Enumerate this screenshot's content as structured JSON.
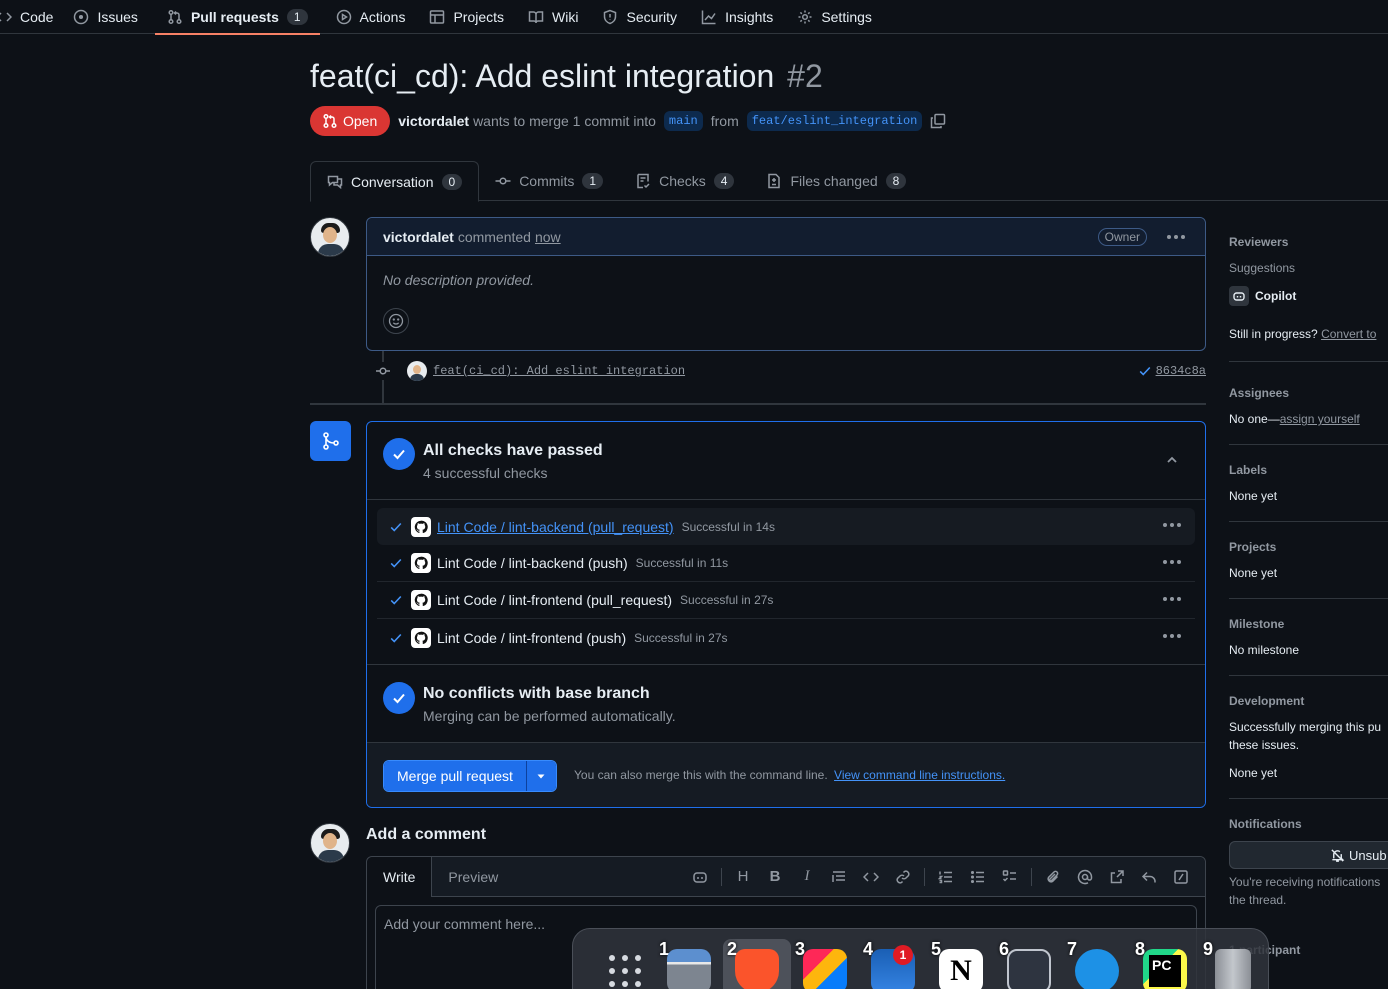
{
  "topnav": {
    "tabs": [
      {
        "label": "Code",
        "icon": "code-icon"
      },
      {
        "label": "Issues",
        "icon": "issue-icon"
      },
      {
        "label": "Pull requests",
        "icon": "pull-request-icon",
        "count": "1",
        "active": true
      },
      {
        "label": "Actions",
        "icon": "play-icon"
      },
      {
        "label": "Projects",
        "icon": "table-icon"
      },
      {
        "label": "Wiki",
        "icon": "book-icon"
      },
      {
        "label": "Security",
        "icon": "shield-icon"
      },
      {
        "label": "Insights",
        "icon": "graph-icon"
      },
      {
        "label": "Settings",
        "icon": "gear-icon"
      }
    ]
  },
  "pr": {
    "title": "feat(ci_cd): Add eslint integration",
    "number": "#2",
    "state": "Open",
    "author": "victordalet",
    "merge_text": "wants to merge 1 commit into",
    "base_branch": "main",
    "from_text": "from",
    "head_branch": "feat/eslint_integration"
  },
  "prtabs": [
    {
      "label": "Conversation",
      "count": "0",
      "icon": "comment-discussion-icon"
    },
    {
      "label": "Commits",
      "count": "1",
      "icon": "commit-icon"
    },
    {
      "label": "Checks",
      "count": "4",
      "icon": "checklist-icon"
    },
    {
      "label": "Files changed",
      "count": "8",
      "icon": "file-diff-icon"
    }
  ],
  "comment": {
    "author": "victordalet",
    "action": "commented",
    "when": "now",
    "badge": "Owner",
    "body": "No description provided."
  },
  "commit": {
    "message": "feat(ci_cd): Add eslint integration",
    "sha": "8634c8a"
  },
  "checks": {
    "title": "All checks have passed",
    "subtitle": "4 successful checks",
    "items": [
      {
        "name": "Lint Code / lint-backend (pull_request)",
        "status": "Successful in 14s"
      },
      {
        "name": "Lint Code / lint-backend (push)",
        "status": "Successful in 11s"
      },
      {
        "name": "Lint Code / lint-frontend (pull_request)",
        "status": "Successful in 27s"
      },
      {
        "name": "Lint Code / lint-frontend (push)",
        "status": "Successful in 27s"
      }
    ]
  },
  "conflicts": {
    "title": "No conflicts with base branch",
    "subtitle": "Merging can be performed automatically."
  },
  "merge": {
    "button": "Merge pull request",
    "hint": "You can also merge this with the command line.",
    "link": "View command line instructions."
  },
  "add_comment": {
    "title": "Add a comment",
    "write_tab": "Write",
    "preview_tab": "Preview",
    "placeholder": "Add your comment here...",
    "heading_glyph": "H",
    "bold_glyph": "B",
    "italic_glyph": "I"
  },
  "sidebar": {
    "reviewers": {
      "title": "Reviewers",
      "suggestions": "Suggestions",
      "copilot": "Copilot",
      "progress": "Still in progress?",
      "convert": "Convert to"
    },
    "assignees": {
      "title": "Assignees",
      "value": "No one—",
      "link": "assign yourself"
    },
    "labels": {
      "title": "Labels",
      "value": "None yet"
    },
    "projects": {
      "title": "Projects",
      "value": "None yet"
    },
    "milestone": {
      "title": "Milestone",
      "value": "No milestone"
    },
    "development": {
      "title": "Development",
      "line1": "Successfully merging this pu",
      "line2": "these issues.",
      "value": "None yet"
    },
    "notifications": {
      "title": "Notifications",
      "button": "Unsub",
      "line1": "You're receiving notifications",
      "line2": "the thread."
    },
    "participants": {
      "title": "1 participant"
    }
  },
  "dock": {
    "items": [
      {
        "num": "1",
        "icon": "file-manager-icon"
      },
      {
        "num": "2",
        "icon": "brave-browser-icon"
      },
      {
        "num": "3",
        "icon": "jetbrains-toolbox-icon"
      },
      {
        "num": "4",
        "icon": "email-client-icon",
        "badge": "1"
      },
      {
        "num": "5",
        "icon": "notion-icon"
      },
      {
        "num": "6",
        "icon": "system-monitor-icon"
      },
      {
        "num": "7",
        "icon": "docker-icon"
      },
      {
        "num": "8",
        "icon": "pycharm-icon"
      },
      {
        "num": "9",
        "icon": "trash-icon"
      }
    ],
    "notion_letter": "N",
    "pycharm_letters": "PC"
  }
}
